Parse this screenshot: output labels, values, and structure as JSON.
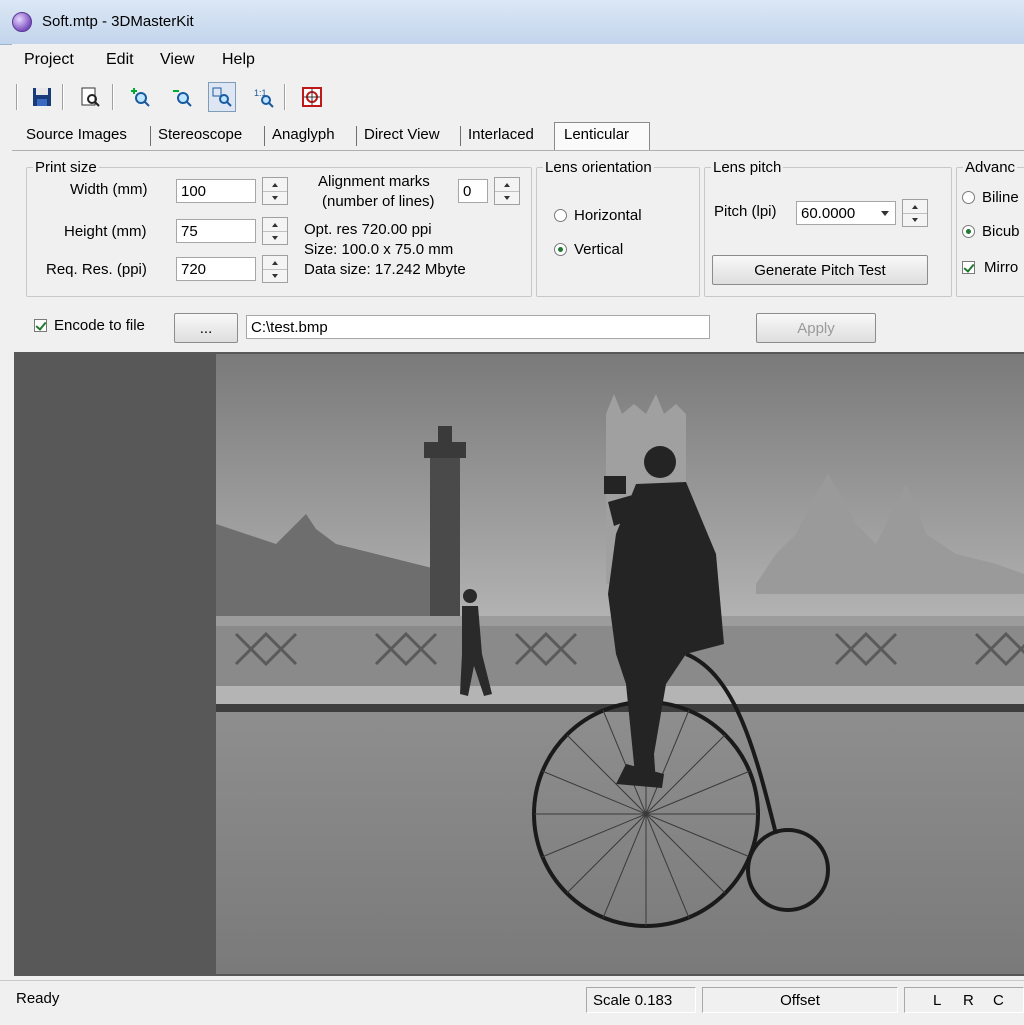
{
  "window": {
    "title": "Soft.mtp - 3DMasterKit"
  },
  "menu": [
    "Project",
    "Edit",
    "View",
    "Help"
  ],
  "toolbar": {
    "buttons": [
      "save-icon",
      "print-preview-icon",
      "zoom-in-icon",
      "zoom-out-icon",
      "zoom-fit-icon",
      "zoom-actual-icon",
      "lenticular-settings-icon"
    ]
  },
  "tabs": [
    "Source Images",
    "Stereoscope",
    "Anaglyph",
    "Direct View",
    "Interlaced",
    "Lenticular"
  ],
  "active_tab": "Lenticular",
  "print_size": {
    "legend": "Print size",
    "width_label": "Width  (mm)",
    "width_value": "100",
    "height_label": "Height  (mm)",
    "height_value": "75",
    "res_label": "Req. Res. (ppi)",
    "res_value": "720"
  },
  "alignment": {
    "label_line1": "Alignment marks",
    "label_line2": "(number of lines)",
    "value": "0"
  },
  "info": {
    "opt_res": "Opt. res 720.00 ppi",
    "size": "Size: 100.0 x 75.0 mm",
    "data_size": "Data size: 17.242 Mbyte"
  },
  "lens_orientation": {
    "legend": "Lens orientation",
    "horizontal": "Horizontal",
    "vertical": "Vertical",
    "selected": "Vertical"
  },
  "lens_pitch": {
    "legend": "Lens pitch",
    "pitch_label": "Pitch (lpi)",
    "pitch_value": "60.0000",
    "generate_button": "Generate Pitch Test"
  },
  "advanced": {
    "legend": "Advanc",
    "bilinear": "Biline",
    "bicubic": "Bicub",
    "mirror": "Mirro"
  },
  "encode": {
    "label": "Encode to file",
    "checked": true,
    "browse_button": "...",
    "path_value": "C:\\test.bmp",
    "apply_button": "Apply"
  },
  "statusbar": {
    "ready": "Ready",
    "scale": "Scale  0.183",
    "offset": "Offset",
    "l": "L",
    "r": "R",
    "c": "C"
  }
}
